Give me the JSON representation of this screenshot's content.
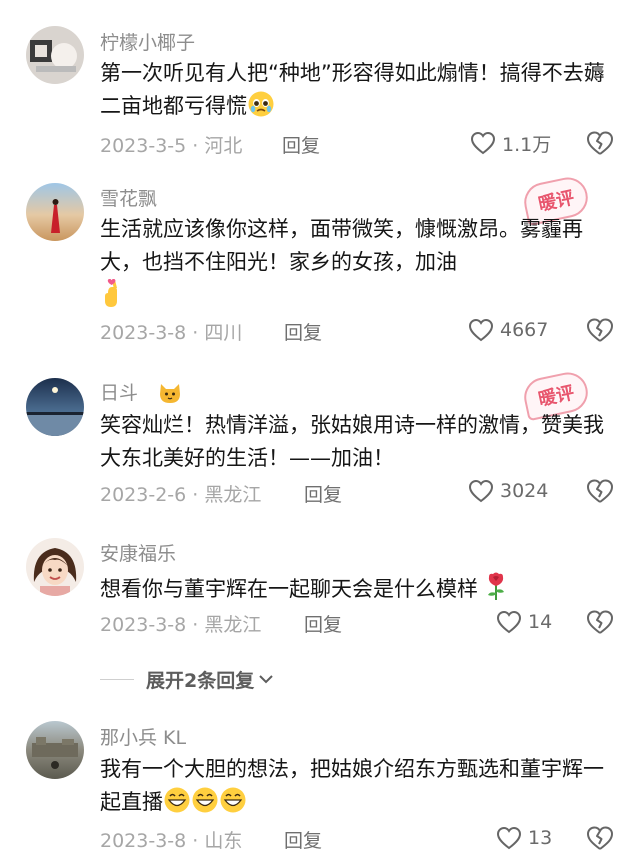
{
  "comments": [
    {
      "username": "柠檬小椰子",
      "text": "第一次听见有人把“种地”形容得如此煽情！搞得不去薅二亩地都亏得慌",
      "date_location": "2023-3-5 · 河北",
      "reply_label": "回复",
      "likes": "1.1万",
      "emoji": "pleading-face"
    },
    {
      "username": "雪花飘",
      "text": "生活就应该像你这样，面带微笑，慷慨激昂。雾霾再大，也挡不住阳光！家乡的女孩，加油",
      "date_location": "2023-3-8 · 四川",
      "reply_label": "回复",
      "likes": "4667",
      "badge": "暖评",
      "emoji": "finger-heart"
    },
    {
      "username": "日斗",
      "text": "笑容灿烂！热情洋溢，张姑娘用诗一样的激情，赞美我大东北美好的生活！——加油！",
      "date_location": "2023-2-6 · 黑龙江",
      "reply_label": "回复",
      "likes": "3024",
      "badge": "暖评",
      "emoji": "cat-face"
    },
    {
      "username": "安康福乐",
      "text": "想看你与董宇辉在一起聊天会是什么模样",
      "date_location": "2023-3-8 · 黑龙江",
      "reply_label": "回复",
      "likes": "14",
      "emoji": "rose"
    },
    {
      "username": "那小兵 KL",
      "text": "我有一个大胆的想法，把姑娘介绍东方甄选和董宇辉一起直播",
      "date_location": "2023-3-8 · 山东",
      "reply_label": "回复",
      "likes": "13",
      "emoji": "grinning-face"
    }
  ],
  "expand_replies": "展开2条回复",
  "colors": {
    "badge": "#e8566e",
    "meta": "#a6a6a6",
    "username": "#8d8d8d"
  }
}
